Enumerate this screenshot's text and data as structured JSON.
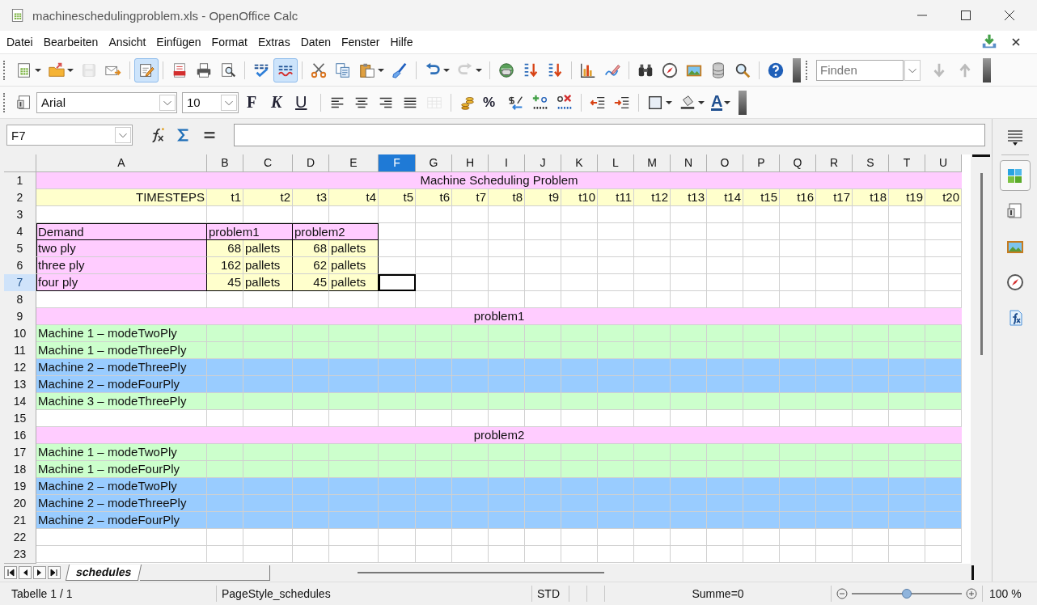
{
  "window": {
    "title": "machineschedulingproblem.xls - OpenOffice Calc"
  },
  "menu": [
    "Datei",
    "Bearbeiten",
    "Ansicht",
    "Einfügen",
    "Format",
    "Extras",
    "Daten",
    "Fenster",
    "Hilfe"
  ],
  "standard_toolbar": {
    "groups": [
      {
        "buttons": [
          {
            "kind": "new",
            "dropdown": true,
            "pressed": false,
            "disabled": false
          },
          {
            "kind": "open",
            "dropdown": true,
            "pressed": false,
            "disabled": false
          },
          {
            "kind": "save",
            "dropdown": false,
            "pressed": false,
            "disabled": true
          },
          {
            "kind": "mail",
            "dropdown": false,
            "pressed": false,
            "disabled": false
          }
        ]
      },
      {
        "buttons": [
          {
            "kind": "edit",
            "dropdown": false,
            "pressed": true,
            "disabled": false
          }
        ]
      },
      {
        "buttons": [
          {
            "kind": "pdf",
            "dropdown": false,
            "pressed": false,
            "disabled": false
          },
          {
            "kind": "print",
            "dropdown": false,
            "pressed": false,
            "disabled": false
          },
          {
            "kind": "preview",
            "dropdown": false,
            "pressed": false,
            "disabled": false
          }
        ]
      },
      {
        "buttons": [
          {
            "kind": "spell",
            "dropdown": false,
            "pressed": false,
            "disabled": false
          },
          {
            "kind": "autospell",
            "dropdown": false,
            "pressed": true,
            "disabled": false
          }
        ]
      },
      {
        "buttons": [
          {
            "kind": "cut",
            "dropdown": false,
            "pressed": false,
            "disabled": false
          },
          {
            "kind": "copy",
            "dropdown": false,
            "pressed": false,
            "disabled": false
          },
          {
            "kind": "paste",
            "dropdown": true,
            "pressed": false,
            "disabled": false
          },
          {
            "kind": "brush",
            "dropdown": false,
            "pressed": false,
            "disabled": false
          }
        ]
      },
      {
        "buttons": [
          {
            "kind": "undo",
            "dropdown": true,
            "pressed": false,
            "disabled": false
          },
          {
            "kind": "redo",
            "dropdown": true,
            "pressed": false,
            "disabled": true
          }
        ]
      },
      {
        "buttons": [
          {
            "kind": "globe",
            "dropdown": false,
            "pressed": false,
            "disabled": false
          },
          {
            "kind": "sortasc",
            "dropdown": false,
            "pressed": false,
            "disabled": false
          },
          {
            "kind": "sortdesc",
            "dropdown": false,
            "pressed": false,
            "disabled": false
          }
        ]
      },
      {
        "buttons": [
          {
            "kind": "chart",
            "dropdown": false,
            "pressed": false,
            "disabled": false
          },
          {
            "kind": "draw",
            "dropdown": false,
            "pressed": false,
            "disabled": false
          }
        ]
      },
      {
        "buttons": [
          {
            "kind": "find",
            "dropdown": false,
            "pressed": false,
            "disabled": false
          },
          {
            "kind": "navigator",
            "dropdown": false,
            "pressed": false,
            "disabled": false
          },
          {
            "kind": "gallery",
            "dropdown": false,
            "pressed": false,
            "disabled": false
          },
          {
            "kind": "database",
            "dropdown": false,
            "pressed": false,
            "disabled": false
          },
          {
            "kind": "zoom",
            "dropdown": false,
            "pressed": false,
            "disabled": false
          }
        ]
      },
      {
        "buttons": [
          {
            "kind": "help",
            "dropdown": false,
            "pressed": false,
            "disabled": false
          }
        ]
      }
    ]
  },
  "find_toolbar": {
    "placeholder": "Finden"
  },
  "formatting_toolbar": {
    "font_name": "Arial",
    "font_size": "10",
    "groups": [
      {
        "buttons": [
          {
            "kind": "styles",
            "dropdown": false,
            "disabled": false
          }
        ]
      },
      {
        "buttons": [
          {
            "kind": "bold",
            "text": "F",
            "dropdown": false,
            "disabled": false
          },
          {
            "kind": "italic",
            "text": "K",
            "dropdown": false,
            "disabled": false
          },
          {
            "kind": "underline",
            "text": "U",
            "dropdown": false,
            "disabled": false
          }
        ]
      },
      {
        "buttons": [
          {
            "kind": "left",
            "dropdown": false,
            "disabled": false
          },
          {
            "kind": "center",
            "dropdown": false,
            "disabled": false
          },
          {
            "kind": "right",
            "dropdown": false,
            "disabled": false
          },
          {
            "kind": "justify",
            "dropdown": false,
            "disabled": false
          },
          {
            "kind": "merge",
            "dropdown": false,
            "disabled": true
          }
        ]
      },
      {
        "buttons": [
          {
            "kind": "currency",
            "dropdown": false,
            "disabled": false
          },
          {
            "kind": "percent",
            "text": "%",
            "dropdown": false,
            "disabled": false
          },
          {
            "kind": "stdformat",
            "dropdown": false,
            "disabled": false
          },
          {
            "kind": "adddec",
            "dropdown": false,
            "disabled": false
          },
          {
            "kind": "deldec",
            "dropdown": false,
            "disabled": false
          }
        ]
      },
      {
        "buttons": [
          {
            "kind": "outdent",
            "dropdown": false,
            "disabled": false
          },
          {
            "kind": "indent",
            "dropdown": false,
            "disabled": false
          }
        ]
      },
      {
        "buttons": [
          {
            "kind": "borders",
            "dropdown": true,
            "disabled": false
          },
          {
            "kind": "bgcolor",
            "dropdown": true,
            "disabled": false
          },
          {
            "kind": "fontcolor",
            "text": "A",
            "dropdown": true,
            "disabled": false
          }
        ]
      }
    ]
  },
  "formula_bar": {
    "name_box": "F7"
  },
  "sheet": {
    "columns": [
      {
        "label": "A",
        "selected": false
      },
      {
        "label": "B",
        "selected": false
      },
      {
        "label": "C",
        "selected": false
      },
      {
        "label": "D",
        "selected": false
      },
      {
        "label": "E",
        "selected": false
      },
      {
        "label": "F",
        "selected": true
      },
      {
        "label": "G",
        "selected": false
      },
      {
        "label": "H",
        "selected": false
      },
      {
        "label": "I",
        "selected": false
      },
      {
        "label": "J",
        "selected": false
      },
      {
        "label": "K",
        "selected": false
      },
      {
        "label": "L",
        "selected": false
      },
      {
        "label": "M",
        "selected": false
      },
      {
        "label": "N",
        "selected": false
      },
      {
        "label": "O",
        "selected": false
      },
      {
        "label": "P",
        "selected": false
      },
      {
        "label": "Q",
        "selected": false
      },
      {
        "label": "R",
        "selected": false
      },
      {
        "label": "S",
        "selected": false
      },
      {
        "label": "T",
        "selected": false
      },
      {
        "label": "U",
        "selected": false
      }
    ],
    "rows": [
      {
        "number": "1",
        "kind": "title",
        "selected": false,
        "text": "Machine Scheduling Problem",
        "color": "#ffccff"
      },
      {
        "number": "2",
        "kind": "timesteps",
        "selected": false,
        "color": "#ffffcc",
        "cells": [
          "TIMESTEPS",
          "t1",
          "t2",
          "t3",
          "t4",
          "t5",
          "t6",
          "t7",
          "t8",
          "t9",
          "t10",
          "t11",
          "t12",
          "t13",
          "t14",
          "t15",
          "t16",
          "t17",
          "t18",
          "t19",
          "t20"
        ]
      },
      {
        "number": "3",
        "kind": "blank",
        "selected": false
      },
      {
        "number": "4",
        "kind": "demand_header",
        "selected": false,
        "label": "Demand",
        "headers": [
          "problem1",
          "problem2"
        ]
      },
      {
        "number": "5",
        "kind": "demand",
        "selected": false,
        "label": "two ply",
        "amounts": [
          {
            "value": "68",
            "unit": "pallets"
          },
          {
            "value": "68",
            "unit": "pallets"
          }
        ]
      },
      {
        "number": "6",
        "kind": "demand",
        "selected": false,
        "label": "three ply",
        "amounts": [
          {
            "value": "162",
            "unit": "pallets"
          },
          {
            "value": "62",
            "unit": "pallets"
          }
        ]
      },
      {
        "number": "7",
        "kind": "demand",
        "selected": true,
        "label": "four ply",
        "amounts": [
          {
            "value": "45",
            "unit": "pallets"
          },
          {
            "value": "45",
            "unit": "pallets"
          }
        ]
      },
      {
        "number": "8",
        "kind": "blank",
        "selected": false
      },
      {
        "number": "9",
        "kind": "section",
        "selected": false,
        "text": "problem1",
        "color": "#ffccff"
      },
      {
        "number": "10",
        "kind": "schedule",
        "selected": false,
        "label": "Machine 1 – modeTwoPly",
        "color": "#ccffcc"
      },
      {
        "number": "11",
        "kind": "schedule",
        "selected": false,
        "label": "Machine 1 – modeThreePly",
        "color": "#ccffcc"
      },
      {
        "number": "12",
        "kind": "schedule",
        "selected": false,
        "label": "Machine 2 – modeThreePly",
        "color": "#99ccff"
      },
      {
        "number": "13",
        "kind": "schedule",
        "selected": false,
        "label": "Machine 2 – modeFourPly",
        "color": "#99ccff"
      },
      {
        "number": "14",
        "kind": "schedule",
        "selected": false,
        "label": "Machine 3 – modeThreePly",
        "color": "#ccffcc"
      },
      {
        "number": "15",
        "kind": "blank",
        "selected": false
      },
      {
        "number": "16",
        "kind": "section",
        "selected": false,
        "text": "problem2",
        "color": "#ffccff"
      },
      {
        "number": "17",
        "kind": "schedule",
        "selected": false,
        "label": "Machine 1 – modeTwoPly",
        "color": "#ccffcc"
      },
      {
        "number": "18",
        "kind": "schedule",
        "selected": false,
        "label": "Machine 1 – modeFourPly",
        "color": "#ccffcc"
      },
      {
        "number": "19",
        "kind": "schedule",
        "selected": false,
        "label": "Machine 2 – modeTwoPly",
        "color": "#99ccff"
      },
      {
        "number": "20",
        "kind": "schedule",
        "selected": false,
        "label": "Machine 2 – modeThreePly",
        "color": "#99ccff"
      },
      {
        "number": "21",
        "kind": "schedule",
        "selected": false,
        "label": "Machine 2 – modeFourPly",
        "color": "#99ccff"
      },
      {
        "number": "22",
        "kind": "blank",
        "selected": false
      },
      {
        "number": "23",
        "kind": "blank",
        "selected": false
      }
    ]
  },
  "sheet_tabs": [
    {
      "label": "schedules",
      "selected": true
    }
  ],
  "sidebar": [
    {
      "kind": "properties",
      "selected": true
    },
    {
      "kind": "styles",
      "selected": false
    },
    {
      "kind": "gallery",
      "selected": false
    },
    {
      "kind": "navigator",
      "selected": false
    },
    {
      "kind": "functions",
      "selected": false
    }
  ],
  "status_bar": {
    "sheet": "Tabelle 1 / 1",
    "page_style": "PageStyle_schedules",
    "mode": "STD",
    "sum": "Summe=0",
    "zoom_slider": {
      "level": 0.5
    },
    "zoom": "100 %"
  }
}
